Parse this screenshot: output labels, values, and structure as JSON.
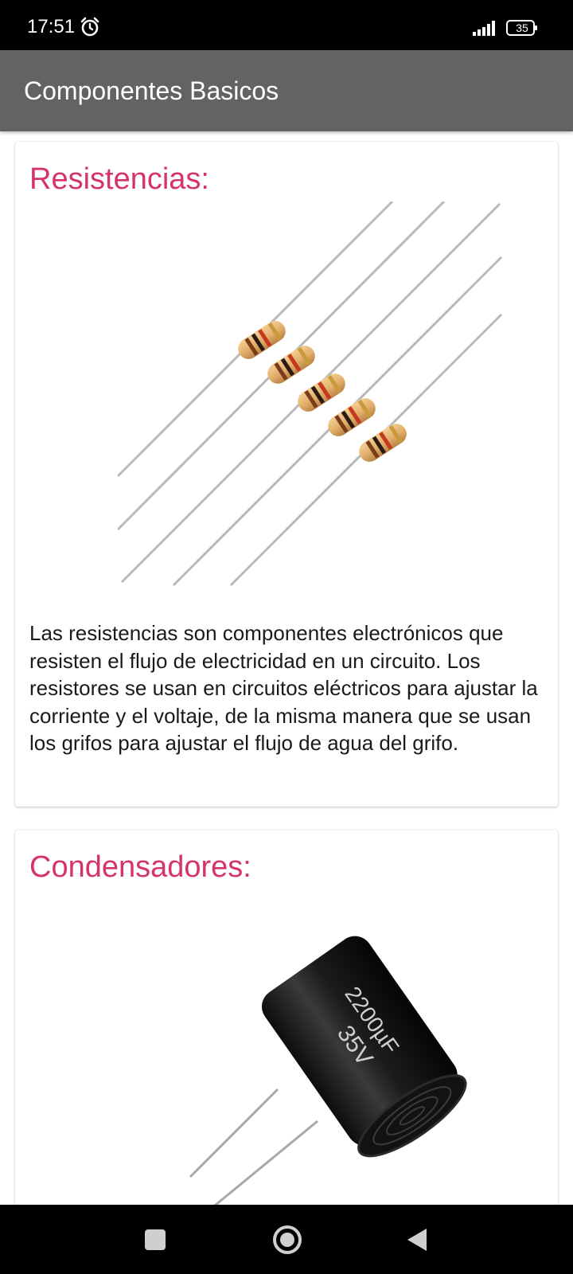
{
  "status_bar": {
    "time": "17:51",
    "battery_level": "35",
    "icons": [
      "alarm-icon",
      "signal-icon",
      "battery-icon"
    ]
  },
  "app_bar": {
    "title": "Componentes Basicos",
    "color": "#636363"
  },
  "cards": [
    {
      "heading": "Resistencias:",
      "image": "resistors-image",
      "description": "Las resistencias son componentes electrónicos que resisten el flujo de electricidad en un circuito. Los resistores se usan en circuitos eléctricos para ajustar la corriente y el voltaje, de la misma manera que se usan los grifos para ajustar el flujo de agua del grifo."
    },
    {
      "heading": "Condensadores:",
      "image": "capacitor-image",
      "image_text": {
        "rating": "35V",
        "capacitance": "2200µF"
      }
    }
  ],
  "nav_bar": {
    "buttons": [
      "recents-icon",
      "home-icon",
      "back-icon"
    ]
  },
  "colors": {
    "heading": "#d6336c",
    "status_bar": "#000000",
    "nav_bar": "#000000"
  }
}
